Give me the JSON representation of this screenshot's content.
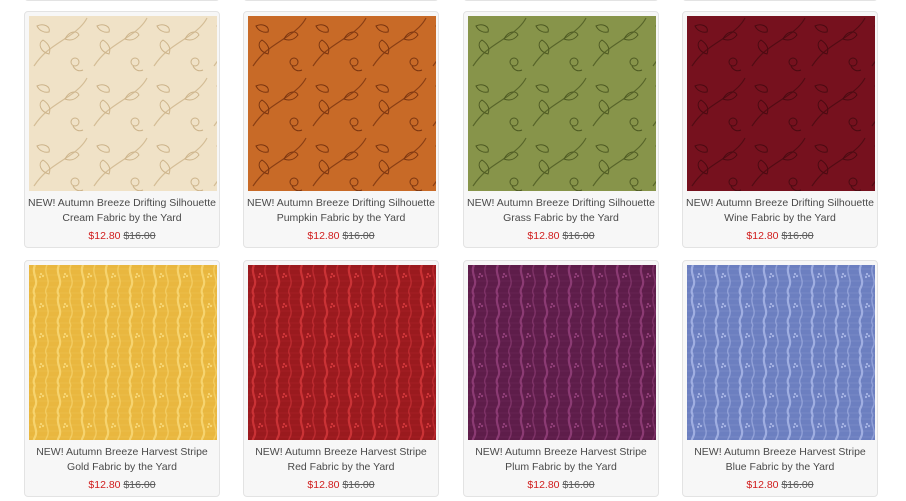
{
  "products": [
    {
      "name": "NEW! Autumn Breeze Drifting Silhouette Cream Fabric by the Yard",
      "sale_price": "$12.80",
      "original_price": "$16.00",
      "pattern": "leaf-silhouette",
      "base_color": "#f4e6cc",
      "ink_color": "#cdb48a"
    },
    {
      "name": "NEW! Autumn Breeze Drifting Silhouette Pumpkin Fabric by the Yard",
      "sale_price": "$12.80",
      "original_price": "$16.00",
      "pattern": "leaf-silhouette",
      "base_color": "#cf6f2a",
      "ink_color": "#7a3510"
    },
    {
      "name": "NEW! Autumn Breeze Drifting Silhouette Grass Fabric by the Yard",
      "sale_price": "$12.80",
      "original_price": "$16.00",
      "pattern": "leaf-silhouette",
      "base_color": "#8c9a4e",
      "ink_color": "#4e5a22"
    },
    {
      "name": "NEW! Autumn Breeze Drifting Silhouette Wine Fabric by the Yard",
      "sale_price": "$12.80",
      "original_price": "$16.00",
      "pattern": "leaf-silhouette",
      "base_color": "#7a1220",
      "ink_color": "#4a0a12"
    },
    {
      "name": "NEW! Autumn Breeze Harvest Stripe Gold Fabric by the Yard",
      "sale_price": "$12.80",
      "original_price": "$16.00",
      "pattern": "harvest-stripe",
      "base_color": "#e9b73f",
      "ink_color": "#f8d877"
    },
    {
      "name": "NEW! Autumn Breeze Harvest Stripe Red Fabric by the Yard",
      "sale_price": "$12.80",
      "original_price": "$16.00",
      "pattern": "harvest-stripe",
      "base_color": "#9a1a1e",
      "ink_color": "#d2363a"
    },
    {
      "name": "NEW! Autumn Breeze Harvest Stripe Plum Fabric by the Yard",
      "sale_price": "$12.80",
      "original_price": "$16.00",
      "pattern": "harvest-stripe",
      "base_color": "#5e1d4a",
      "ink_color": "#93407a"
    },
    {
      "name": "NEW! Autumn Breeze Harvest Stripe Blue Fabric by the Yard",
      "sale_price": "$12.80",
      "original_price": "$16.00",
      "pattern": "harvest-stripe",
      "base_color": "#6c7fc0",
      "ink_color": "#a8b6e6"
    }
  ]
}
